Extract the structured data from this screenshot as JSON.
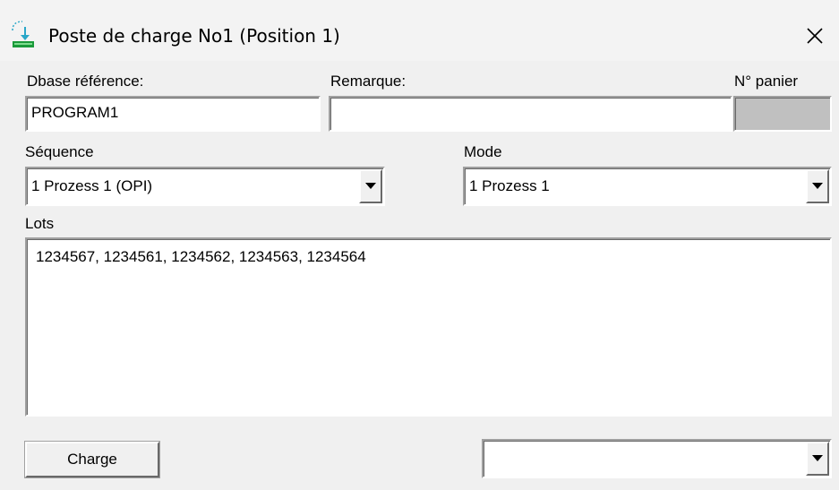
{
  "window": {
    "title": "Poste de charge No1 (Position 1)"
  },
  "dbase": {
    "label": "Dbase référence:",
    "value": "PROGRAM1"
  },
  "remarque": {
    "label": "Remarque:",
    "value": ""
  },
  "panier": {
    "label": "N° panier",
    "value": ""
  },
  "sequence": {
    "label": "Séquence",
    "selected": "1 Prozess 1 (OPI)"
  },
  "mode": {
    "label": "Mode",
    "selected": "1 Prozess 1"
  },
  "lots": {
    "label": "Lots",
    "value": "1234567, 1234561, 1234562, 1234563, 1234564"
  },
  "footer": {
    "charge_label": "Charge",
    "dropdown_selected": ""
  }
}
